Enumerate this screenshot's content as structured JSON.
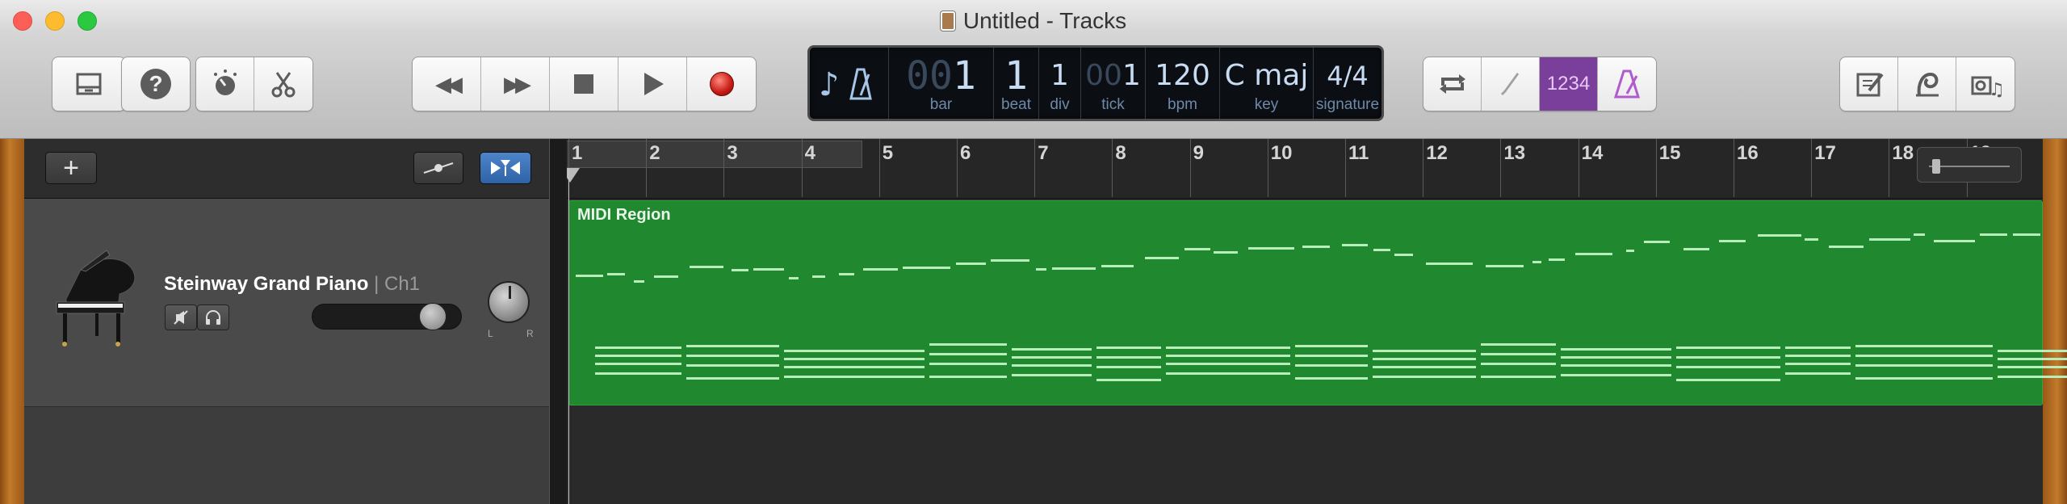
{
  "window": {
    "title": "Untitled - Tracks"
  },
  "toolbar": {
    "library_icon": "library-icon",
    "help_label": "?",
    "smart_controls_icon": "smart-controls-icon",
    "editors_icon": "scissors-icon",
    "rewind_label": "◀◀",
    "forward_label": "▶▶",
    "stop_icon": "stop-icon",
    "play_icon": "play-icon",
    "record_icon": "record-icon",
    "cycle_icon": "cycle-icon",
    "tuner_icon": "tuner-icon",
    "count_in_label": "1234",
    "metronome_icon": "metronome-icon",
    "notepad_icon": "notepad-icon",
    "loop_browser_icon": "loop-icon",
    "media_browser_icon": "media-browser-icon"
  },
  "lcd": {
    "bar_value": "1",
    "bar_label": "bar",
    "beat_value": "1",
    "beat_label": "beat",
    "div_value": "1",
    "div_label": "div",
    "tick_value": "1",
    "tick_label": "tick",
    "bpm_value": "120",
    "bpm_label": "bpm",
    "key_value": "C maj",
    "key_label": "key",
    "signature_value": "4/4",
    "signature_label": "signature"
  },
  "tracks_header": {
    "add_label": "+"
  },
  "ruler": {
    "bars": [
      "1",
      "2",
      "3",
      "4",
      "5",
      "6",
      "7",
      "8",
      "9",
      "10",
      "11",
      "12",
      "13",
      "14",
      "15",
      "16",
      "17",
      "18",
      "19"
    ]
  },
  "track": {
    "name": "Steinway Grand Piano",
    "channel": "| Ch1",
    "pan_left": "L",
    "pan_right": "R",
    "volume_level": 0.72
  },
  "region": {
    "name": "MIDI Region",
    "color": "#20882f"
  },
  "colors": {
    "accent_purple": "#7a3f9a",
    "region_green": "#20882f",
    "lcd_bg": "#0b0f14"
  }
}
